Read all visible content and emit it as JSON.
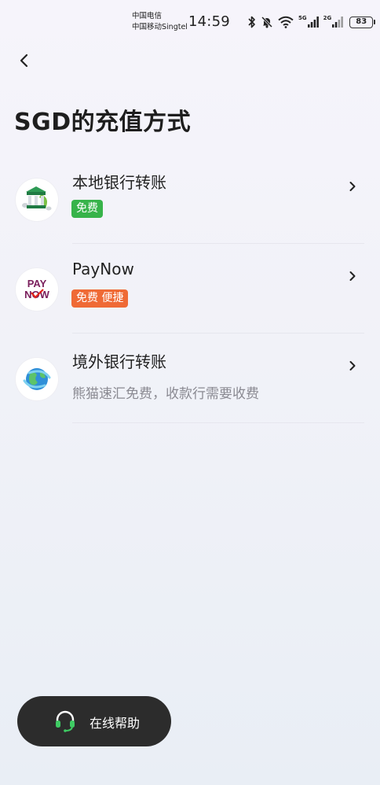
{
  "status_bar": {
    "carrier_1": "中国电信",
    "carrier_2": "中国移动Singtel",
    "time": "14:59",
    "net_1": "5G",
    "net_2": "2G",
    "battery": "83"
  },
  "page": {
    "title": "SGD的充值方式"
  },
  "methods": [
    {
      "name": "本地银行转账",
      "tag": "免费",
      "tag_color": "#37b34a",
      "icon": "bank-icon"
    },
    {
      "name": "PayNow",
      "tag": "免费 便捷",
      "tag_color": "#ef6a35",
      "icon": "paynow-logo",
      "logo_text_1": "PAY",
      "logo_text_2": "NOW"
    },
    {
      "name": "境外银行转账",
      "subtitle": "熊猫速汇免费，收款行需要收费",
      "icon": "globe-icon"
    }
  ],
  "help": {
    "label": "在线帮助",
    "icon": "headset-icon"
  },
  "colors": {
    "accent_green": "#37b34a",
    "accent_orange": "#ef6a35",
    "help_bg": "#2c2c2c"
  }
}
